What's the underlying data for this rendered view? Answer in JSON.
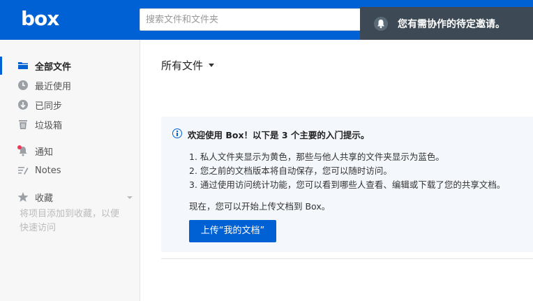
{
  "header": {
    "logo": "box",
    "search_placeholder": "搜索文件和文件夹",
    "notification": "您有需协作的待定邀请。"
  },
  "sidebar": {
    "items": [
      {
        "label": "全部文件",
        "icon": "folder-icon",
        "active": true
      },
      {
        "label": "最近使用",
        "icon": "clock-icon"
      },
      {
        "label": "已同步",
        "icon": "sync-icon"
      },
      {
        "label": "垃圾箱",
        "icon": "trash-icon"
      },
      {
        "label": "通知",
        "icon": "bell-icon"
      },
      {
        "label": "Notes",
        "icon": "notes-icon"
      },
      {
        "label": "收藏",
        "icon": "star-icon"
      }
    ],
    "favorites_hint": "将项目添加到收藏，以便快速访问"
  },
  "main": {
    "title": "所有文件",
    "welcome": {
      "heading": "欢迎使用 Box！以下是 3 个主要的入门提示。",
      "tips": [
        "1. 私人文件夹显示为黄色，那些与他人共享的文件夹显示为蓝色。",
        "2. 您之前的文档版本将自动保存，您可以随时访问。",
        "3. 通过使用访问统计功能，您可以看到哪些人查看、编辑或下载了您的共享文档。"
      ],
      "start_text": "现在，您可以开始上传文档到 Box。",
      "upload_label": "上传“我的文档”"
    }
  },
  "colors": {
    "brand": "#0061d5",
    "toast_bg": "#3d4a55",
    "sidebar_bg": "#f7f7f8",
    "welcome_bg": "#f4f7fb",
    "notification_dot": "#ed3757"
  }
}
